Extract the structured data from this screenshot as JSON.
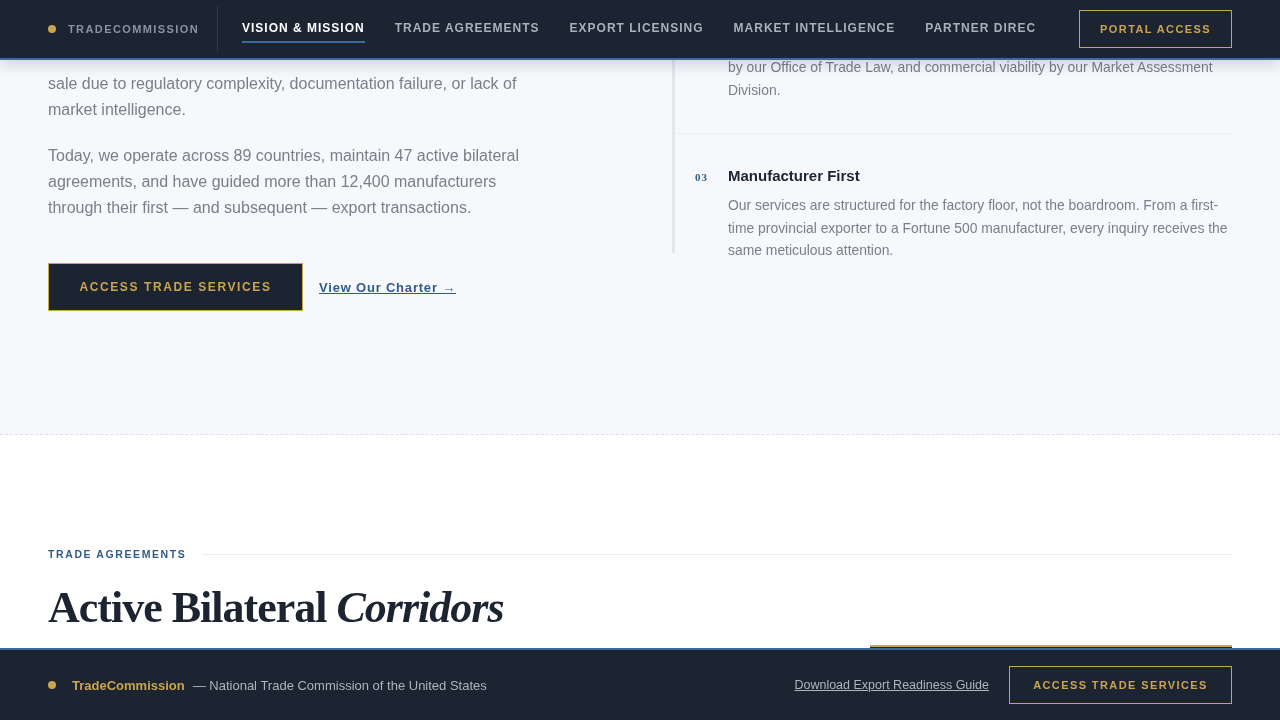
{
  "header": {
    "brand": "TRADECOMMISSION",
    "nav": [
      {
        "label": "VISION & MISSION",
        "selected": true
      },
      {
        "label": "TRADE AGREEMENTS",
        "selected": false
      },
      {
        "label": "EXPORT LICENSING",
        "selected": false
      },
      {
        "label": "MARKET INTELLIGENCE",
        "selected": false
      },
      {
        "label": "PARTNER DIREC",
        "selected": false
      }
    ],
    "cta": "PORTAL ACCESS"
  },
  "mission": {
    "paragraphs": [
      "sale due to regulatory complexity, documentation failure, or lack of market intelligence.",
      "Today, we operate across 89 countries, maintain 47 active bilateral agreements, and have guided more than 12,400 manufacturers through their first — and subsequent — export transactions."
    ],
    "primary_button": "ACCESS TRADE SERVICES",
    "link": "View Our Charter →",
    "principles": [
      {
        "text": "by our Office of Trade Law, and commercial viability by our Market Assessment Division."
      },
      {
        "number": "03",
        "title": "Manufacturer First",
        "text": "Our services are structured for the factory floor, not the boardroom. From a first-time provincial exporter to a Fortune 500 manufacturer, every inquiry receives the same meticulous attention."
      }
    ]
  },
  "agreements": {
    "eyebrow": "TRADE AGREEMENTS",
    "heading": "Active Bilateral *Corridors*"
  },
  "footer": {
    "brand": "TradeCommission",
    "tagline": "— National Trade Commission of the United States",
    "link": "Download Export Readiness Guide",
    "button": "ACCESS TRADE SERVICES"
  }
}
